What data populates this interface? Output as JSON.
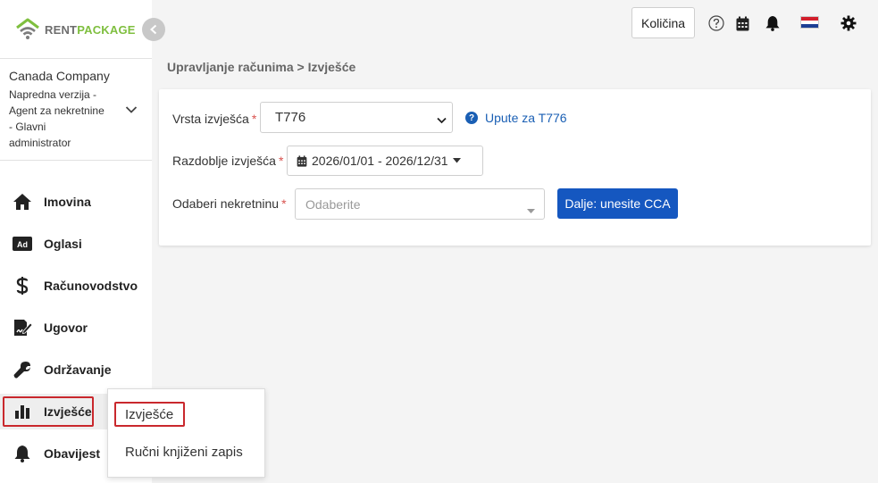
{
  "brand": {
    "name_part1": "RENT",
    "name_part2": "PACKAGE",
    "colors": {
      "green": "#7fbf3f",
      "gray": "#6e6e6e"
    }
  },
  "account": {
    "company": "Canada Company",
    "role": "Napredna verzija - Agent za nekretnine - Glavni administrator"
  },
  "nav": {
    "items": [
      {
        "label": "Imovina",
        "icon": "home-icon"
      },
      {
        "label": "Oglasi",
        "icon": "ad-icon"
      },
      {
        "label": "Računovodstvo",
        "icon": "dollar-icon"
      },
      {
        "label": "Ugovor",
        "icon": "contract-icon"
      },
      {
        "label": "Održavanje",
        "icon": "wrench-icon"
      },
      {
        "label": "Izvješće",
        "icon": "bar-chart-icon",
        "active": true
      },
      {
        "label": "Obavijest",
        "icon": "bell-icon"
      }
    ]
  },
  "submenu": {
    "items": [
      {
        "label": "Izvješće",
        "selected": true
      },
      {
        "label": "Ručni knjiženi zapis"
      }
    ]
  },
  "topbar": {
    "quantity_label": "Količina",
    "icons": [
      "help-icon",
      "calendar-icon",
      "bell-icon",
      "croatia-flag-icon",
      "gear-icon"
    ]
  },
  "breadcrumb": "Upravljanje računima > Izvješće",
  "form": {
    "report_type": {
      "label": "Vrsta izvješća",
      "value": "T776"
    },
    "help_link": "Upute za T776",
    "period": {
      "label": "Razdoblje izvješća",
      "value": "2026/01/01 - 2026/12/31"
    },
    "property": {
      "label": "Odaberi nekretninu",
      "placeholder": "Odaberite"
    },
    "next_button": "Dalje: unesite CCA",
    "required_mark": "*"
  },
  "colors": {
    "primary": "#1557c0",
    "highlight_outline": "#c9282d",
    "required": "#d9534f"
  }
}
